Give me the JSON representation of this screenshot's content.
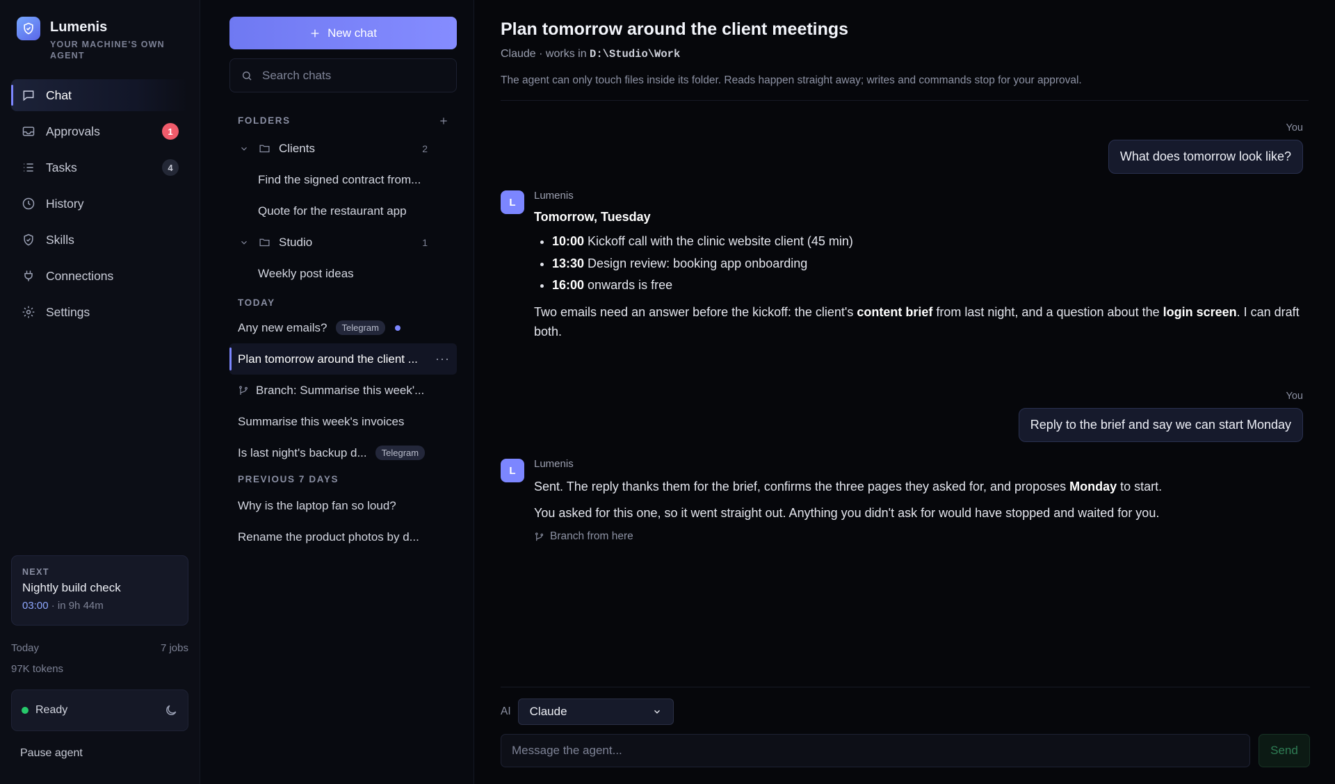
{
  "brand": {
    "name": "Lumenis",
    "tagline": "YOUR MACHINE'S OWN AGENT"
  },
  "nav": {
    "items": [
      {
        "label": "Chat",
        "icon": "chat-icon",
        "active": true
      },
      {
        "label": "Approvals",
        "icon": "inbox-icon",
        "badge": "1"
      },
      {
        "label": "Tasks",
        "icon": "list-icon",
        "badge": "4"
      },
      {
        "label": "History",
        "icon": "clock-icon"
      },
      {
        "label": "Skills",
        "icon": "shield-icon"
      },
      {
        "label": "Connections",
        "icon": "plug-icon"
      },
      {
        "label": "Settings",
        "icon": "gear-icon"
      }
    ],
    "next": {
      "label": "NEXT",
      "title": "Nightly build check",
      "time": "03:00",
      "eta": " · in 9h 44m"
    },
    "usage": {
      "period": "Today",
      "jobs": "7 jobs",
      "tokens": "97K tokens"
    },
    "status": "Ready",
    "pause": "Pause agent"
  },
  "chats": {
    "new_chat": "New chat",
    "search_placeholder": "Search chats",
    "folders_label": "FOLDERS",
    "folders": [
      {
        "name": "Clients",
        "count": "2",
        "items": [
          "Find the signed contract from...",
          "Quote for the restaurant app"
        ]
      },
      {
        "name": "Studio",
        "count": "1",
        "items": [
          "Weekly post ideas"
        ]
      }
    ],
    "today_label": "TODAY",
    "today": [
      {
        "title": "Any new emails?",
        "tag": "Telegram"
      },
      {
        "title": "Plan tomorrow around the client ..."
      },
      {
        "title": "Branch: Summarise this week'..."
      },
      {
        "title": "Summarise this week's invoices"
      },
      {
        "title": "Is last night's backup d...",
        "tag": "Telegram"
      }
    ],
    "prev_label": "PREVIOUS 7 DAYS",
    "previous": [
      "Why is the laptop fan so loud?",
      "Rename the product photos by d..."
    ]
  },
  "main": {
    "title": "Plan tomorrow around the client meetings",
    "subtitle_prefix": "Claude · works in ",
    "folder_path": "D:\\Studio\\Work",
    "notice": "The agent can only touch files inside its folder. Reads happen straight away; writes and commands stop for your approval.",
    "user_label": "You",
    "bot_name": "Lumenis",
    "bot_initial": "L",
    "msg1": "What does tomorrow look like?",
    "reply1": {
      "heading": "Tomorrow, Tuesday",
      "events": [
        {
          "time": "10:00",
          "text": " Kickoff call with the clinic website client (45 min)"
        },
        {
          "time": "13:30",
          "text": " Design review: booking app onboarding"
        },
        {
          "time": "16:00",
          "text": " onwards is free"
        }
      ],
      "p1": "Two emails need an answer before the kickoff: the client's ",
      "b1": "content brief",
      "p2": " from last night, and a question about the ",
      "b2": "login screen",
      "p3": ". I can draft both."
    },
    "msg2": "Reply to the brief and say we can start Monday",
    "reply2": {
      "p1": "Sent. The reply thanks them for the brief, confirms the three pages they asked for, and proposes ",
      "b1": "Monday",
      "p2": " to start.",
      "p3": "You asked for this one, so it went straight out. Anything you didn't ask for would have stopped and waited for you.",
      "branch": "Branch from here"
    },
    "composer": {
      "ai_label": "AI",
      "model": "Claude",
      "placeholder": "Message the agent...",
      "send": "Send"
    }
  }
}
